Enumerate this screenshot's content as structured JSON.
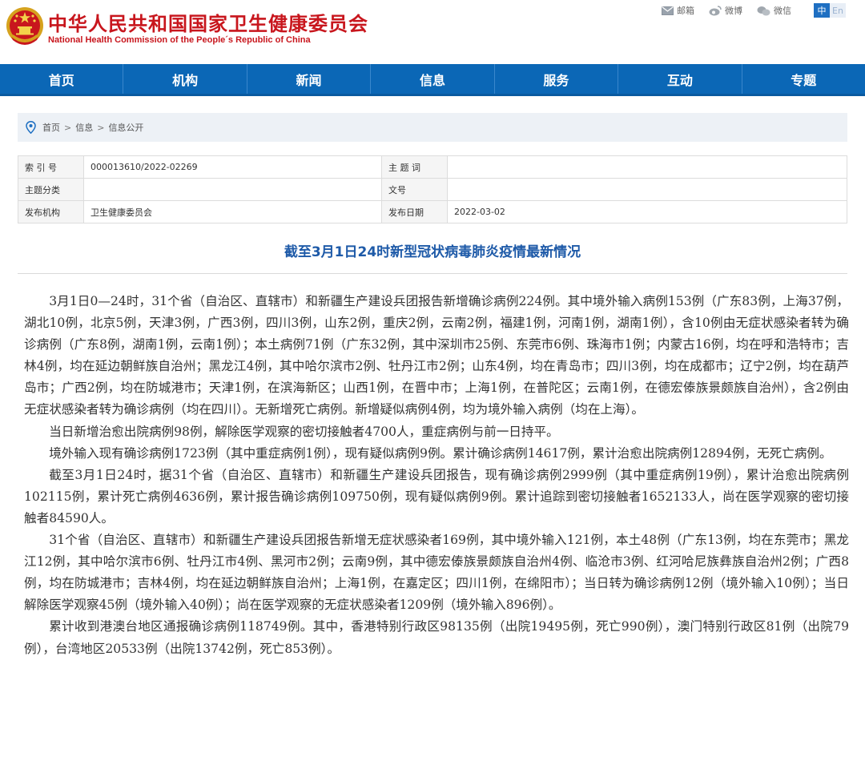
{
  "header": {
    "title_cn": "中华人民共和国国家卫生健康委员会",
    "title_en": "National Health Commission of the People´s Republic of China",
    "emblem_icon": "national-emblem-icon",
    "links": [
      {
        "label": "邮箱",
        "icon": "mail-icon"
      },
      {
        "label": "微博",
        "icon": "weibo-icon"
      },
      {
        "label": "微信",
        "icon": "wechat-icon"
      }
    ],
    "lang_active": "中",
    "lang_other": "En"
  },
  "nav": {
    "items": [
      "首页",
      "机构",
      "新闻",
      "信息",
      "服务",
      "互动",
      "专题"
    ]
  },
  "breadcrumb": {
    "icon": "location-pin-icon",
    "items": [
      "首页",
      "信息",
      "信息公开"
    ],
    "separator": ">"
  },
  "meta": {
    "index_label": "索 引 号",
    "index_value": "000013610/2022-02269",
    "subject_word_label": "主 题 词",
    "subject_word_value": "",
    "category_label": "主题分类",
    "category_value": "",
    "doc_no_label": "文号",
    "doc_no_value": "",
    "publisher_label": "发布机构",
    "publisher_value": "卫生健康委员会",
    "date_label": "发布日期",
    "date_value": "2022-03-02"
  },
  "article": {
    "title": "截至3月1日24时新型冠状病毒肺炎疫情最新情况",
    "paragraphs": [
      "3月1日0—24时，31个省（自治区、直辖市）和新疆生产建设兵团报告新增确诊病例224例。其中境外输入病例153例（广东83例，上海37例，湖北10例，北京5例，天津3例，广西3例，四川3例，山东2例，重庆2例，云南2例，福建1例，河南1例，湖南1例），含10例由无症状感染者转为确诊病例（广东8例，湖南1例，云南1例）；本土病例71例（广东32例，其中深圳市25例、东莞市6例、珠海市1例；内蒙古16例，均在呼和浩特市；吉林4例，均在延边朝鲜族自治州；黑龙江4例，其中哈尔滨市2例、牡丹江市2例；山东4例，均在青岛市；四川3例，均在成都市；辽宁2例，均在葫芦岛市；广西2例，均在防城港市；天津1例，在滨海新区；山西1例，在晋中市；上海1例，在普陀区；云南1例，在德宏傣族景颇族自治州），含2例由无症状感染者转为确诊病例（均在四川）。无新增死亡病例。新增疑似病例4例，均为境外输入病例（均在上海）。",
      "当日新增治愈出院病例98例，解除医学观察的密切接触者4700人，重症病例与前一日持平。",
      "境外输入现有确诊病例1723例（其中重症病例1例），现有疑似病例9例。累计确诊病例14617例，累计治愈出院病例12894例，无死亡病例。",
      "截至3月1日24时，据31个省（自治区、直辖市）和新疆生产建设兵团报告，现有确诊病例2999例（其中重症病例19例），累计治愈出院病例102115例，累计死亡病例4636例，累计报告确诊病例109750例，现有疑似病例9例。累计追踪到密切接触者1652133人，尚在医学观察的密切接触者84590人。",
      "31个省（自治区、直辖市）和新疆生产建设兵团报告新增无症状感染者169例，其中境外输入121例，本土48例（广东13例，均在东莞市；黑龙江12例，其中哈尔滨市6例、牡丹江市4例、黑河市2例；云南9例，其中德宏傣族景颇族自治州4例、临沧市3例、红河哈尼族彝族自治州2例；广西8例，均在防城港市；吉林4例，均在延边朝鲜族自治州；上海1例，在嘉定区；四川1例，在绵阳市）；当日转为确诊病例12例（境外输入10例）；当日解除医学观察45例（境外输入40例）；尚在医学观察的无症状感染者1209例（境外输入896例）。",
      "累计收到港澳台地区通报确诊病例118749例。其中，香港特别行政区98135例（出院19495例，死亡990例），澳门特别行政区81例（出院79例），台湾地区20533例（出院13742例，死亡853例）。"
    ]
  },
  "colors": {
    "brand_red": "#c8161d",
    "nav_blue": "#0b67b6",
    "title_blue": "#1e5aa8"
  }
}
